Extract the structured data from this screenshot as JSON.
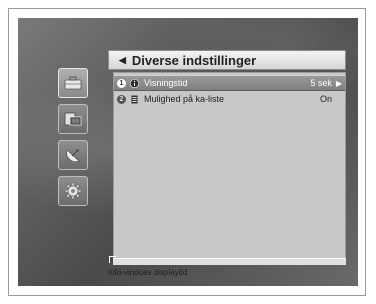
{
  "menu": {
    "title": "Diverse indstillinger",
    "items": [
      {
        "number": "1",
        "icon": "info-icon",
        "label": "Visningstid",
        "value": "5 sek",
        "selected": true
      },
      {
        "number": "2",
        "icon": "list-icon",
        "label": "Mulighed på ka-liste",
        "value": "On",
        "selected": false
      }
    ]
  },
  "sidebar": {
    "icons": [
      "toolbox-icon",
      "monitor-icon",
      "satellite-dish-icon",
      "gear-icon"
    ]
  },
  "help_text": "Info-vindues displaytid"
}
